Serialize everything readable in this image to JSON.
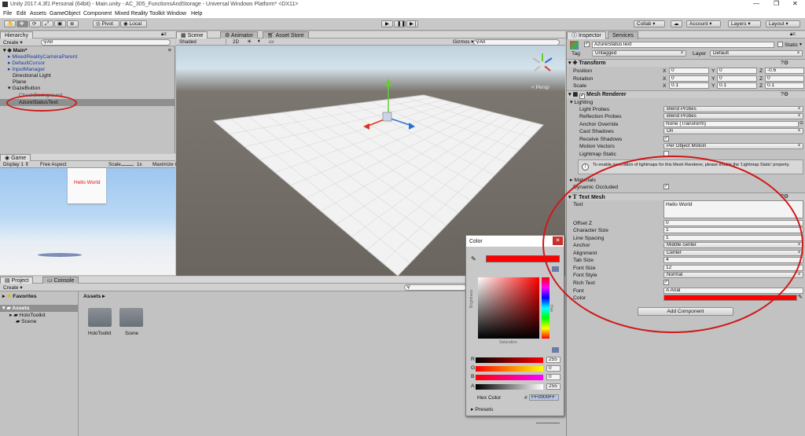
{
  "window": {
    "title": "Unity 2017.4.3f1 Personal (64bit) - Main.unity - AC_305_FunctionsAndStorage - Universal Windows Platform* <DX11>"
  },
  "menu": [
    "File",
    "Edit",
    "Assets",
    "GameObject",
    "Component",
    "Mixed Reality Toolkit",
    "Window",
    "Help"
  ],
  "toolbar": {
    "pivot": "Pivot",
    "local": "Local",
    "collab": "Collab ▾",
    "account": "Account",
    "layers": "Layers",
    "layout": "Layout"
  },
  "hierarchy": {
    "tab": "Hierarchy",
    "create": "Create ▾",
    "search_placeholder": "All",
    "scene": "Main*",
    "items": [
      {
        "label": "MixedRealityCameraParent",
        "blue": true
      },
      {
        "label": "DefaultCursor",
        "blue": true
      },
      {
        "label": "InputManager",
        "blue": true
      },
      {
        "label": "Directional Light",
        "blue": false
      },
      {
        "label": "Plane",
        "blue": false
      },
      {
        "label": "GazeButton",
        "blue": false
      },
      {
        "label": "AzureStatusText",
        "blue": false
      }
    ],
    "hidden_child": "CheckBackground"
  },
  "game": {
    "tab": "Game",
    "display": "Display 1",
    "aspect": "Free Aspect",
    "scale_label": "Scale",
    "scale_value": "1x",
    "maximize": "Maximize O",
    "hello": "Hello World"
  },
  "scene": {
    "tab": "Scene",
    "tab2": "Animator",
    "tab3": "Asset Store",
    "shaded": "Shaded",
    "mode2d": "2D",
    "gizmos": "Gizmos ▾",
    "search_placeholder": "All",
    "persp": "< Persp"
  },
  "project": {
    "tab": "Project",
    "tab2": "Console",
    "create": "Create ▾",
    "favorites": "Favorites",
    "assets": "Assets",
    "folders": [
      "HoloToolkit",
      "Scene"
    ],
    "breadcrumb": "Assets ▸",
    "grid_items": [
      "HoloToolkit",
      "Scene"
    ]
  },
  "color_picker": {
    "title": "Color",
    "r_label": "R",
    "g_label": "G",
    "b_label": "B",
    "a_label": "A",
    "r": "255",
    "g": "0",
    "b": "0",
    "a": "255",
    "hex_label": "Hex Color",
    "hex_hash": "#",
    "hex": "FF0000FF",
    "presets": "Presets",
    "saturation": "Saturation",
    "brightness": "Brightness",
    "hue": "Hue"
  },
  "inspector": {
    "tab": "Inspector",
    "tab2": "Services",
    "object_name": "AzureStatusText",
    "static": "Static",
    "tag_label": "Tag",
    "tag": "Untagged",
    "layer_label": "Layer",
    "layer": "Default",
    "transform": {
      "title": "Transform",
      "position_label": "Position",
      "rotation_label": "Rotation",
      "scale_label": "Scale",
      "position": [
        "0",
        "0",
        "-0.6"
      ],
      "rotation": [
        "0",
        "0",
        "0"
      ],
      "scale": [
        "0.1",
        "0.1",
        "0.1"
      ],
      "x": "X",
      "y": "Y",
      "z": "Z"
    },
    "mesh_renderer": {
      "title": "Mesh Renderer",
      "lighting": "Lighting",
      "light_probes_label": "Light Probes",
      "light_probes": "Blend Probes",
      "reflection_label": "Reflection Probes",
      "reflection": "Blend Probes",
      "anchor_label": "Anchor Override",
      "anchor": "None (Transform)",
      "cast_label": "Cast Shadows",
      "cast": "On",
      "receive_label": "Receive Shadows",
      "motion_label": "Motion Vectors",
      "motion": "Per Object Motion",
      "lightmap_label": "Lightmap Static",
      "info": "To enable generation of lightmaps for this Mesh Renderer, please enable the 'Lightmap Static' property.",
      "materials": "Materials",
      "dynamic": "Dynamic Occluded"
    },
    "text_mesh": {
      "title": "Text Mesh",
      "text_label": "Text",
      "text": "Hello World",
      "offset_label": "Offset Z",
      "offset": "0",
      "char_label": "Character Size",
      "char": "1",
      "spacing_label": "Line Spacing",
      "spacing": "1",
      "anchor_label": "Anchor",
      "anchor": "Middle center",
      "align_label": "Alignment",
      "align": "Center",
      "tab_label": "Tab Size",
      "tab": "4",
      "size_label": "Font Size",
      "size": "12",
      "style_label": "Font Style",
      "style": "Normal",
      "rich_label": "Rich Text",
      "font_label": "Font",
      "font": "Arial",
      "color_label": "Color"
    },
    "add_component": "Add Component"
  },
  "colors": {
    "text_red": "#ff0000",
    "sky_top": "#9ec6f0",
    "scene_floor": "#6a655e"
  }
}
